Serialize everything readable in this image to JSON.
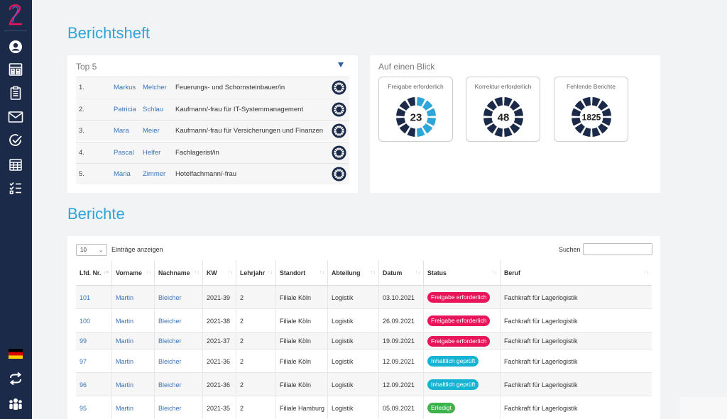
{
  "nav": {
    "icons": [
      "user-icon",
      "dashboard-icon",
      "clipboard-icon",
      "mail-icon",
      "check-circle-icon",
      "calendar-icon",
      "checklist-icon"
    ],
    "bottom_icons": [
      "german-flag-icon",
      "swap-icon",
      "team-icon"
    ]
  },
  "page": {
    "title": "Berichtsheft",
    "reports_title": "Berichte"
  },
  "top5": {
    "heading": "Top 5",
    "rows": [
      {
        "num": "1.",
        "first": "Markus",
        "last": "Melcher",
        "job": "Feuerungs- und Schornsteinbauer/in"
      },
      {
        "num": "2.",
        "first": "Patricia",
        "last": "Schlau",
        "job": "Kaufmann/-frau für IT-Systemmanagement"
      },
      {
        "num": "3.",
        "first": "Mara",
        "last": "Meier",
        "job": "Kaufmann/-frau für Versicherungen und Finanzen"
      },
      {
        "num": "4.",
        "first": "Pascal",
        "last": "Helfer",
        "job": "Fachlagerist/in"
      },
      {
        "num": "5.",
        "first": "Maria",
        "last": "Zimmer",
        "job": "Hotelfachmann/-frau"
      }
    ]
  },
  "glance": {
    "heading": "Auf einen Blick",
    "stats": [
      {
        "label": "Freigabe erforderlich",
        "value": "23",
        "highlight": 6,
        "segments": 12
      },
      {
        "label": "Korrektur erforderlich",
        "value": "48",
        "highlight": 0,
        "segments": 12
      },
      {
        "label": "Fehlende Berichte",
        "value": "1825",
        "highlight": 0,
        "segments": 12
      }
    ]
  },
  "table": {
    "length_value": "10",
    "length_label": "Einträge anzeigen",
    "search_label": "Suchen",
    "search_value": "",
    "columns": [
      "Lfd. Nr.",
      "Vorname",
      "Nachname",
      "KW",
      "Lehrjahr",
      "Standort",
      "Abteilung",
      "Datum",
      "Status",
      "Beruf"
    ],
    "rows": [
      {
        "nr": "101",
        "first": "Martin",
        "last": "Bleicher",
        "kw": "2021-39",
        "year": "2",
        "site": "Filiale Köln",
        "dept": "Logistik",
        "date": "03.10.2021",
        "status": "Freigabe erforderlich",
        "status_type": "pink",
        "job": "Fachkraft für Lagerlogistik"
      },
      {
        "nr": "100",
        "first": "Martin",
        "last": "Bleicher",
        "kw": "2021-38",
        "year": "2",
        "site": "Filiale Köln",
        "dept": "Logistik",
        "date": "26.09.2021",
        "status": "Freigabe erforderlich",
        "status_type": "pink",
        "job": "Fachkraft für Lagerlogistik"
      },
      {
        "nr": "99",
        "first": "Martin",
        "last": "Bleicher",
        "kw": "2021-37",
        "year": "2",
        "site": "Filiale Köln",
        "dept": "Logistik",
        "date": "19.09.2021",
        "status": "Freigabe erforderlich",
        "status_type": "pink",
        "job": "Fachkraft für Lagerlogistik"
      },
      {
        "nr": "97",
        "first": "Martin",
        "last": "Bleicher",
        "kw": "2021-36",
        "year": "2",
        "site": "Filiale Köln",
        "dept": "Logistik",
        "date": "12.09.2021",
        "status": "Inhaltlich geprüft",
        "status_type": "cyan",
        "job": "Fachkraft für Lagerlogistik"
      },
      {
        "nr": "96",
        "first": "Martin",
        "last": "Bleicher",
        "kw": "2021-36",
        "year": "2",
        "site": "Filiale Köln",
        "dept": "Logistik",
        "date": "12.09.2021",
        "status": "Inhaltlich geprüft",
        "status_type": "cyan",
        "job": "Fachkraft für Lagerlogistik"
      },
      {
        "nr": "95",
        "first": "Martin",
        "last": "Bleicher",
        "kw": "2021-35",
        "year": "2",
        "site": "Filiale Hamburg",
        "dept": "Logistik",
        "date": "05.09.2021",
        "status": "Erledigt",
        "status_type": "green",
        "job": "Fachkraft für Lagerlogistik"
      }
    ]
  },
  "colors": {
    "accent": "#2fa4d6",
    "sidebar": "#1c2a4a",
    "link": "#3a73b8",
    "ring_dark": "#1c2a4a",
    "ring_light": "#2fa4d6",
    "pink": "#e8155b",
    "cyan": "#16b4d2",
    "green": "#3cb44b"
  }
}
